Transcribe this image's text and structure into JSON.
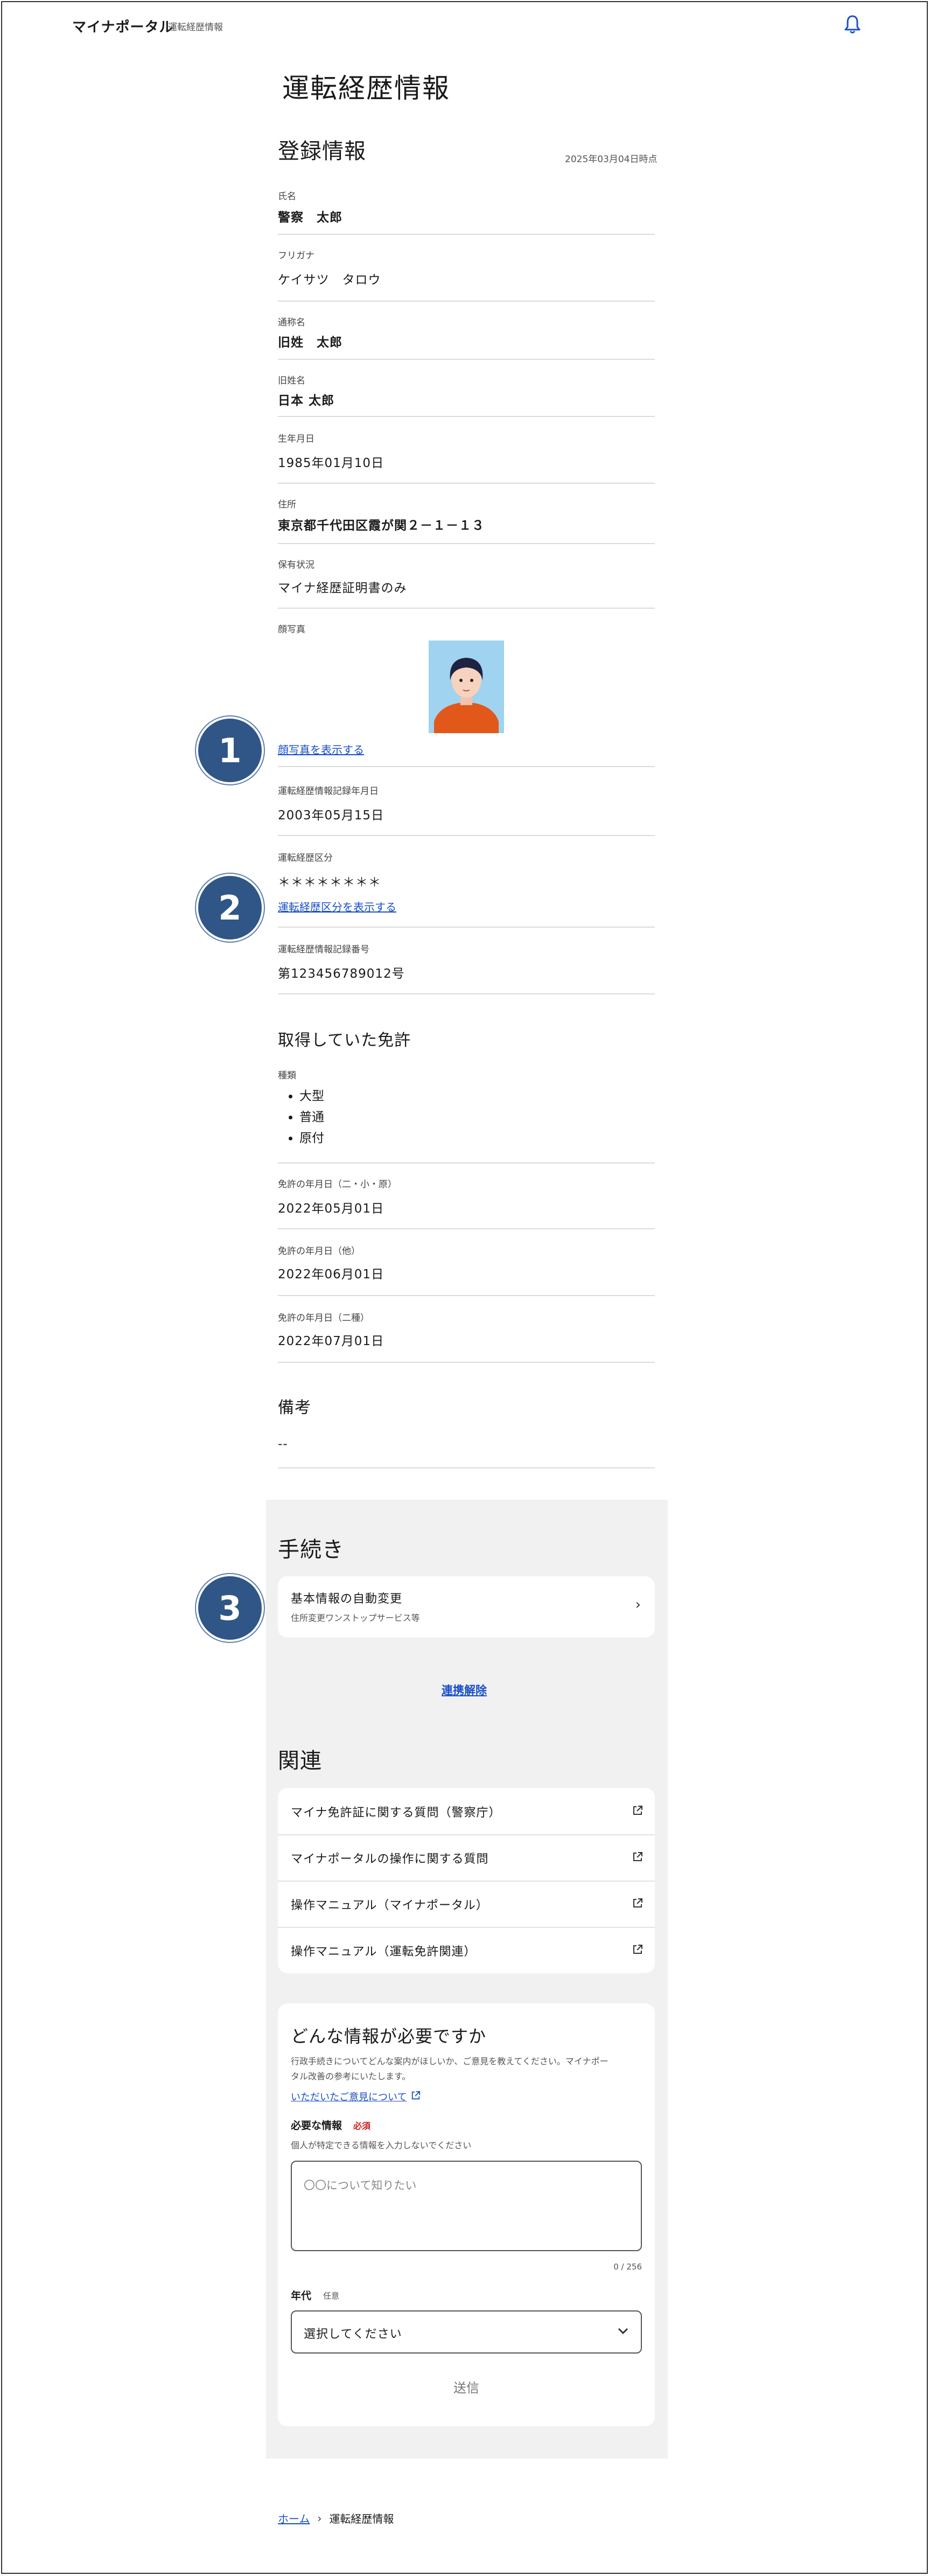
{
  "header": {
    "title": "マイナポータル",
    "subtitle": "運転経歴情報"
  },
  "page_title": "運転経歴情報",
  "registration": {
    "heading": "登録情報",
    "as_of": "2025年03月04日時点",
    "fields": [
      {
        "label": "氏名",
        "value": "警察　太郎"
      },
      {
        "label": "フリガナ",
        "value": "ケイサツ　タロウ"
      },
      {
        "label": "通称名",
        "value": "旧姓　太郎"
      },
      {
        "label": "旧姓名",
        "value": "日本 太郎"
      },
      {
        "label": "生年月日",
        "value": "1985年01月10日"
      },
      {
        "label": "住所",
        "value": "東京都千代田区霞が関２－１－１３"
      },
      {
        "label": "保有状況",
        "value": "マイナ経歴証明書のみ"
      }
    ],
    "photo_label": "顔写真",
    "photo_link": "顔写真を表示する",
    "record_date_label": "運転経歴情報記録年月日",
    "record_date": "2003年05月15日",
    "category_label": "運転経歴区分",
    "category_masked": "＊＊＊＊＊＊＊＊",
    "category_link": "運転経歴区分を表示する",
    "record_number_label": "運転経歴情報記録番号",
    "record_number": "第123456789012号"
  },
  "licenses": {
    "heading": "取得していた免許",
    "types_label": "種類",
    "types": [
      "大型",
      "普通",
      "原付"
    ],
    "dates": [
      {
        "label": "免許の年月日（二・小・原）",
        "value": "2022年05月01日"
      },
      {
        "label": "免許の年月日（他）",
        "value": "2022年06月01日"
      },
      {
        "label": "免許の年月日（二種）",
        "value": "2022年07月01日"
      }
    ]
  },
  "remarks": {
    "heading": "備考",
    "value": "--"
  },
  "badges": [
    "1",
    "2",
    "3"
  ],
  "procedures": {
    "heading": "手続き",
    "item_title": "基本情報の自動変更",
    "item_sub": "住所変更ワンストップサービス等",
    "unlink": "連携解除"
  },
  "related": {
    "heading": "関連",
    "items": [
      "マイナ免許証に関する質問（警察庁）",
      "マイナポータルの操作に関する質問",
      "操作マニュアル（マイナポータル）",
      "操作マニュアル（運転免許関連）"
    ]
  },
  "feedback": {
    "heading": "どんな情報が必要ですか",
    "desc1": "行政手続きについてどんな案内がほしいか、ご意見を教えてください。マイナポー",
    "desc2": "タル改善の参考にいたします。",
    "opinion_link": "いただいたご意見について",
    "required_label": "必要な情報",
    "required_tag": "必須",
    "required_hint": "個人が特定できる情報を入力しないでください",
    "placeholder": "〇〇について知りたい",
    "counter": "0 / 256",
    "age_label": "年代",
    "age_tag": "任意",
    "age_select": "選択してください",
    "submit": "送信"
  },
  "breadcrumb": {
    "home": "ホーム",
    "current": "運転経歴情報"
  },
  "colors": {
    "link": "#1a4fc7",
    "badge": "#2f5686",
    "panel": "#f1f1f2",
    "required": "#d32020"
  }
}
